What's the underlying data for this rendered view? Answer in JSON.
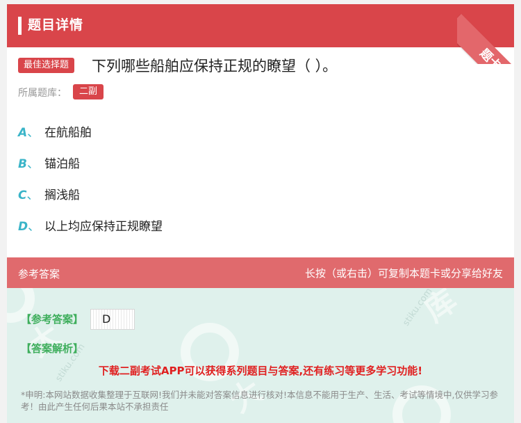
{
  "header": {
    "title": "题目详情",
    "corner_ribbon": "题卡"
  },
  "question": {
    "tag": "最佳选择题",
    "text": "下列哪些船舶应保持正规的瞭望（   ）。",
    "bank_label": "所属题库：",
    "bank_name": "二副"
  },
  "options": [
    {
      "letter": "A",
      "text": "在航船舶"
    },
    {
      "letter": "B",
      "text": "锚泊船"
    },
    {
      "letter": "C",
      "text": "搁浅船"
    },
    {
      "letter": "D",
      "text": "以上均应保持正规瞭望"
    }
  ],
  "answer": {
    "section_title": "参考答案",
    "share_hint": "长按（或右击）可复制本题卡或分享给好友",
    "ref_label": "【参考答案】",
    "ref_value": "D",
    "explain_label": "【答案解析】",
    "promo": "下载二副考试APP可以获得系列题目与答案,还有练习等更多学习功能!",
    "disclaimer": "*申明:本网站数据收集整理于互联网!我们并未能对答案信息进行核对!本信息不能用于生产、生活、考试等情境中,仅供学习参考！由此产生任何后果本站不承担责任"
  },
  "colors": {
    "brand_red": "#d9454a",
    "option_letter": "#3ab4c8",
    "answer_green": "#3eae5c",
    "promo_red": "#e02020"
  }
}
